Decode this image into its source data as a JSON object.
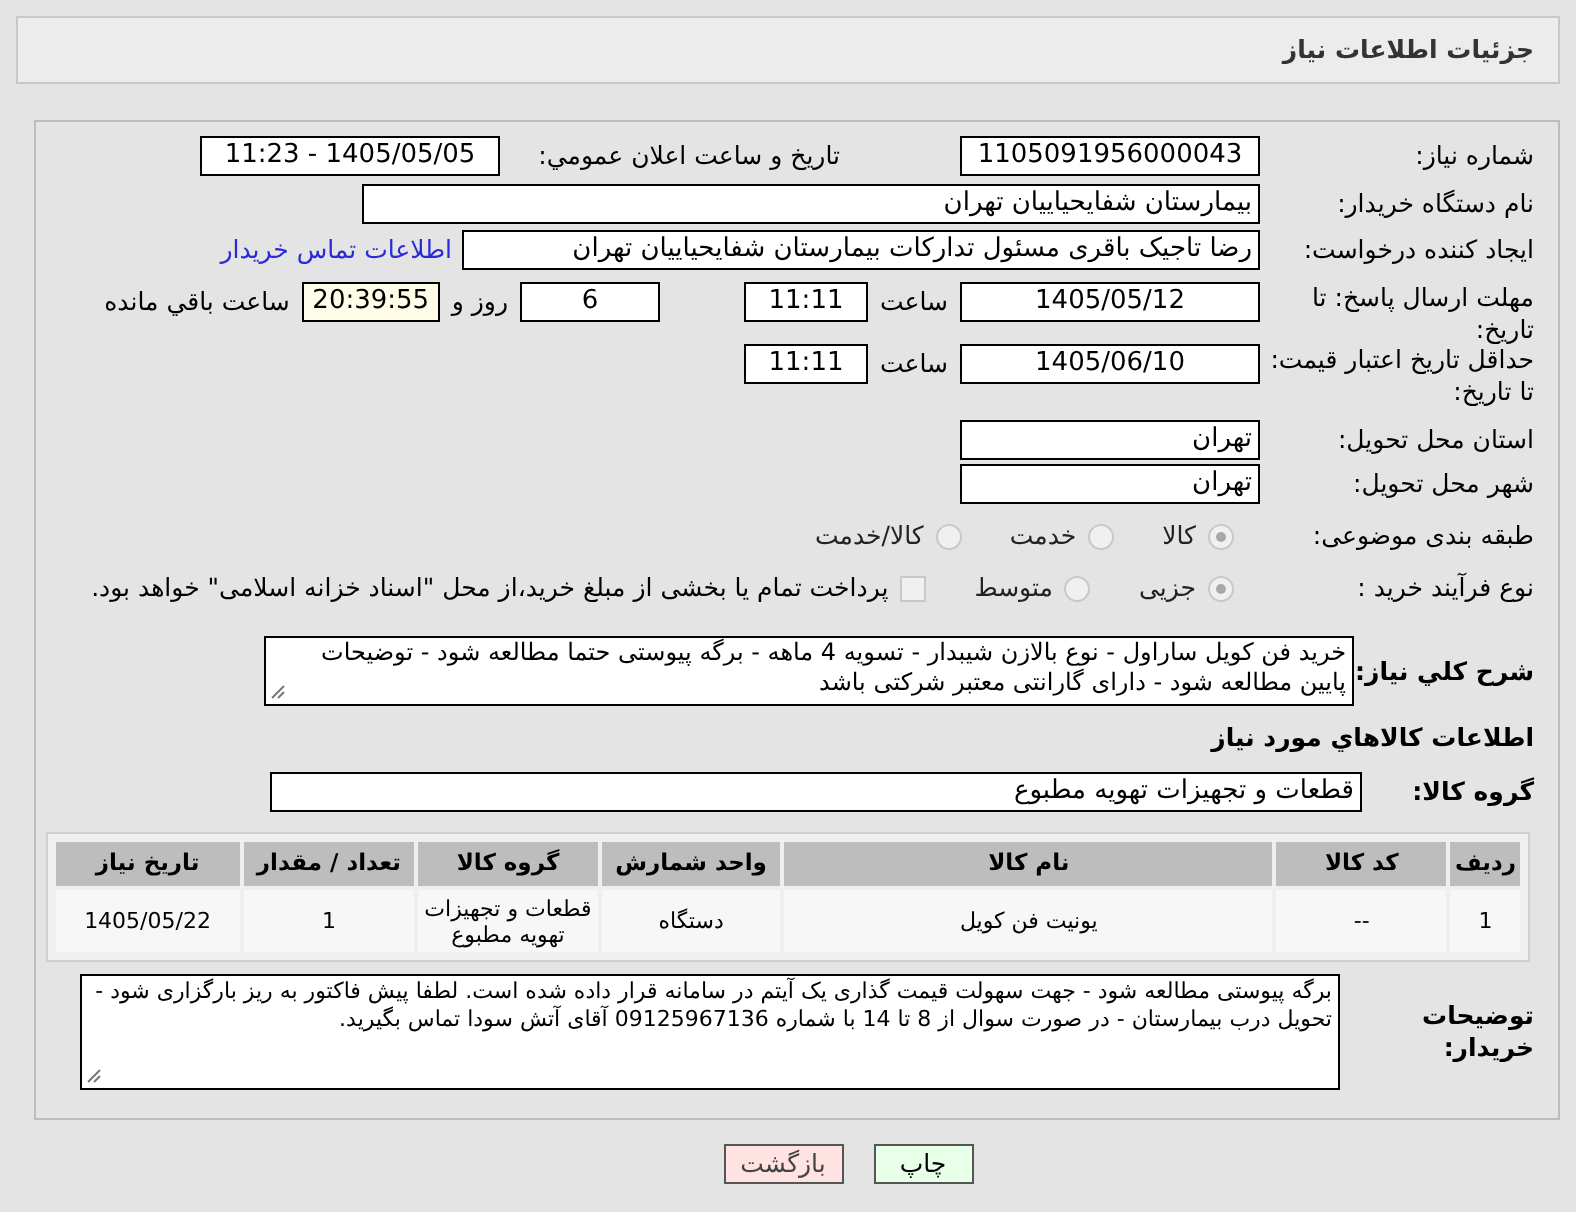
{
  "header": {
    "title": "جزئیات اطلاعات نیاز"
  },
  "fields": {
    "need_number": {
      "label": "شماره نیاز:",
      "value": "1105091956000043"
    },
    "announce": {
      "label": "تاریخ و ساعت اعلان عمومي:",
      "value": "1405/05/05 - 11:23"
    },
    "buyer": {
      "label": "نام دستگاه خریدار:",
      "value": "بیمارستان شفایحیاییان تهران"
    },
    "creator": {
      "label": "ایجاد کننده درخواست:",
      "value": "رضا تاجیک باقری مسئول تدارکات بیمارستان شفایحیاییان تهران",
      "link": "اطلاعات تماس خریدار"
    },
    "deadline": {
      "label": "مهلت ارسال پاسخ: تا تاریخ:",
      "date": "1405/05/12",
      "time_label": "ساعت",
      "time": "11:11",
      "days": "6",
      "days_label": "روز و",
      "remaining": "20:39:55",
      "remaining_label": "ساعت باقي مانده"
    },
    "validity": {
      "label": "حداقل تاریخ اعتبار قیمت: تا تاریخ:",
      "date": "1405/06/10",
      "time_label": "ساعت",
      "time": "11:11"
    },
    "province": {
      "label": "استان محل تحویل:",
      "value": "تهران"
    },
    "city": {
      "label": "شهر محل تحویل:",
      "value": "تهران"
    }
  },
  "category": {
    "label": "طبقه بندی موضوعی:",
    "options": [
      {
        "label": "کالا",
        "selected": true
      },
      {
        "label": "خدمت",
        "selected": false
      },
      {
        "label": "کالا/خدمت",
        "selected": false
      }
    ]
  },
  "process": {
    "label": "نوع فرآیند خرید :",
    "options": [
      {
        "label": "جزیی",
        "selected": true
      },
      {
        "label": "متوسط",
        "selected": false
      }
    ],
    "treasury": {
      "label": "پرداخت تمام یا بخشی از مبلغ خرید،از محل \"اسناد خزانه اسلامی\" خواهد بود.",
      "checked": false
    }
  },
  "description": {
    "label": "شرح کلي نیاز:",
    "value": "خرید فن کویل ساراول - نوع بالازن شیبدار - تسویه 4 ماهه - برگه پیوستی حتما مطالعه شود - توضیحات پایین مطالعه شود - دارای گارانتی معتبر شرکتی باشد"
  },
  "goods_title": "اطلاعات کالاهاي مورد نیاز",
  "goods_group": {
    "label": "گروه کالا:",
    "value": "قطعات و تجهیزات تهویه مطبوع"
  },
  "table": {
    "columns": [
      "ردیف",
      "کد کالا",
      "نام کالا",
      "واحد شمارش",
      "گروه کالا",
      "تعداد / مقدار",
      "تاریخ نیاز"
    ],
    "rows": [
      [
        "1",
        "--",
        "یونیت فن کویل",
        "دستگاه",
        "قطعات و تجهیزات تهویه مطبوع",
        "1",
        "1405/05/22"
      ]
    ]
  },
  "buyer_notes": {
    "label": "توضیحات خریدار:",
    "value": "برگه پیوستی مطالعه شود - جهت سهولت قیمت گذاری یک آیتم در سامانه قرار داده شده است. لطفا پیش فاکتور به ریز بارگزاری شود - تحویل درب بیمارستان - در صورت سوال از 8 تا 14 با شماره 09125967136 آقای آتش سودا تماس بگیرید."
  },
  "buttons": {
    "print": "چاپ",
    "back": "بازگشت"
  }
}
